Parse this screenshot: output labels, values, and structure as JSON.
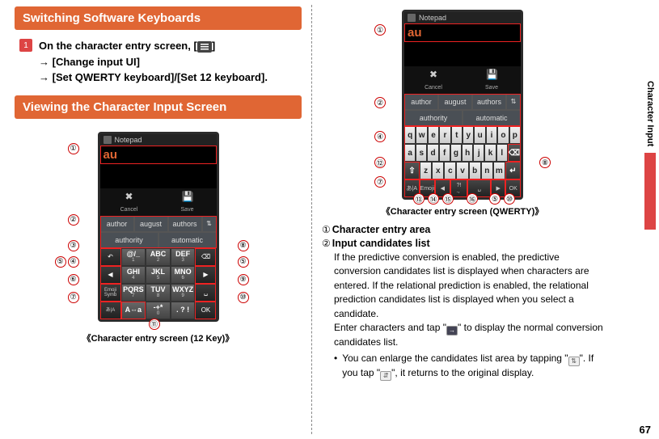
{
  "page_number": "67",
  "side_label": "Character Input",
  "headings": {
    "switch": "Switching Software Keyboards",
    "view": "Viewing the Character Input Screen"
  },
  "step1": {
    "num": "1",
    "line1_a": "On the character entry screen, [",
    "line1_b": "]",
    "line2": "→ [Change input UI]",
    "line3": "→ [Set QWERTY keyboard]/[Set 12 keyboard]."
  },
  "phone_common": {
    "app": "Notepad",
    "brand": "au",
    "cancel": "Cancel",
    "save": "Save"
  },
  "candidates": {
    "row1": [
      "author",
      "august",
      "authors"
    ],
    "row2": [
      "authority",
      "automatic"
    ]
  },
  "keypad12": {
    "r1": [
      "↶",
      "@/_\n1",
      "ABC\n2",
      "DEF\n3",
      "⌫"
    ],
    "r2": [
      "←",
      "GHI\n4",
      "JKL\n5",
      "MNO\n6",
      "→"
    ],
    "r3": [
      "Emoji\nSymb",
      "PQRS\n7",
      "TUV\n8",
      "WXYZ\n9",
      "␣"
    ],
    "r4": [
      "あ| A",
      "A⇔a",
      "-+*\n0",
      ". ? !",
      "OK"
    ]
  },
  "qwerty": {
    "r1": [
      "q",
      "w",
      "e",
      "r",
      "t",
      "y",
      "u",
      "i",
      "o",
      "p"
    ],
    "r2": [
      "a",
      "s",
      "d",
      "f",
      "g",
      "h",
      "j",
      "k",
      "l",
      "⌫"
    ],
    "r3": [
      "⇧",
      "z",
      "x",
      "c",
      "v",
      "b",
      "n",
      "m",
      "↵"
    ]
  },
  "captions": {
    "twelve": "Character entry screen (12 Key)",
    "qwerty": "Character entry screen (QWERTY)"
  },
  "callouts": {
    "one": "①",
    "two": "②",
    "three": "③",
    "four": "④",
    "five": "⑤",
    "six": "⑥",
    "seven": "⑦",
    "eight": "⑧",
    "nine": "⑨",
    "ten": "⑩",
    "eleven": "⑪",
    "twelve": "⑫",
    "thirteen": "⑬",
    "fourteen": "⑭",
    "fifteen": "⑮",
    "sixteen": "⑯"
  },
  "desc": {
    "d1_head": "Character entry area",
    "d2_head": "Input candidates list",
    "d2_body1": "If the predictive conversion is enabled, the predictive conversion candidates list is displayed when characters are entered. If the relational prediction is enabled, the relational prediction candidates list is displayed when you select a candidate.",
    "d2_body2a": "Enter characters and tap \"",
    "d2_body2b": "\" to display the normal conversion candidates list.",
    "d2_sub_a": "You can enlarge the candidates list area by tapping \"",
    "d2_sub_b": "\". If you tap \"",
    "d2_sub_c": "\", it returns to the original display."
  }
}
